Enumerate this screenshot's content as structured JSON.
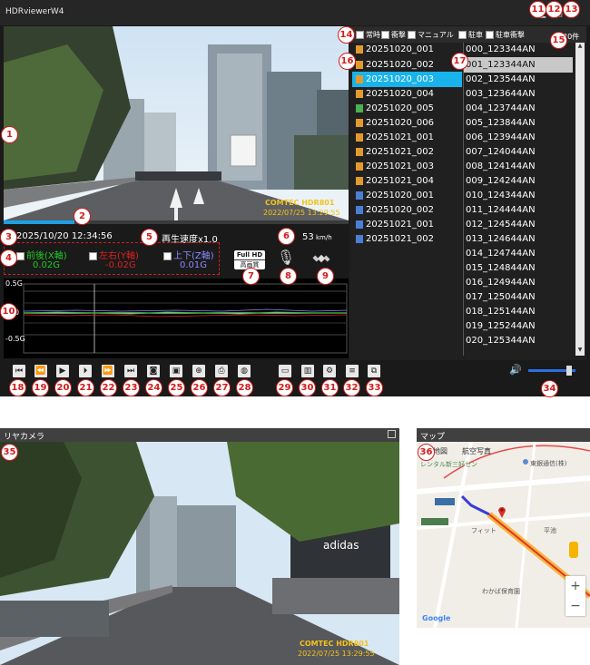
{
  "app": {
    "title": "HDRviewerW4"
  },
  "window_controls": {
    "minimize": "▁",
    "restore": "□",
    "close": "✕"
  },
  "front": {
    "overlay_brand": "COMTEC HDR801",
    "overlay_time": "2022/07/25 13:29:55"
  },
  "info": {
    "datetime": "2025/10/20 12:34:56",
    "playback_speed": "再生速度x1.0",
    "speed": "53",
    "speed_unit": "km/h"
  },
  "gsensor": {
    "items": [
      {
        "label": "前後(X軸)",
        "value": "0.02G",
        "color": "#22cc22"
      },
      {
        "label": "左右(Y軸)",
        "value": "-0.02G",
        "color": "#e02020"
      },
      {
        "label": "上下(Z軸)",
        "value": "0.01G",
        "color": "#8a8aff"
      }
    ],
    "axis_top": "0.5G",
    "axis_mid": "0",
    "axis_bottom": "-0.5G"
  },
  "quality_badge": {
    "line1": "Full HD",
    "line2": "高画質"
  },
  "filters": {
    "items": [
      "常時",
      "衝撃",
      "マニュアル",
      "駐車",
      "駐車衝撃"
    ],
    "count": "20件"
  },
  "files_left": [
    "20251020_001",
    "20251020_002",
    "20251020_003",
    "20251020_004",
    "20251020_005",
    "20251020_006",
    "20251021_001",
    "20251021_002",
    "20251021_003",
    "20251021_004",
    "20251020_001",
    "20251020_002",
    "20251021_001",
    "20251021_002"
  ],
  "files_right": [
    "000_123344AN",
    "001_123344AN",
    "002_123544AN",
    "003_123644AN",
    "004_123744AN",
    "005_123844AN",
    "006_123944AN",
    "007_124044AN",
    "008_124144AN",
    "009_124244AN",
    "010_124344AN",
    "011_124444AN",
    "012_124544AN",
    "013_124644AN",
    "014_124744AN",
    "015_124844AN",
    "016_124944AN",
    "017_125044AN",
    "018_125144AN",
    "019_125244AN",
    "020_125344AN"
  ],
  "rear": {
    "title": "リヤカメラ",
    "overlay_brand": "COMTEC HDR801",
    "overlay_time": "2022/07/25 13:29:55"
  },
  "map": {
    "title": "マップ",
    "tab_map": "地図",
    "tab_sat": "航空写真",
    "zoom_in": "+",
    "zoom_out": "−",
    "logo": "Google",
    "labels": [
      "レンタル新三好セン",
      "東銀通信(株)",
      "フィット",
      "平池",
      "わかば保育園"
    ]
  },
  "callouts": [
    "1",
    "2",
    "3",
    "4",
    "5",
    "6",
    "7",
    "8",
    "9",
    "10",
    "11",
    "12",
    "13",
    "14",
    "15",
    "16",
    "17",
    "18",
    "19",
    "20",
    "21",
    "22",
    "23",
    "24",
    "25",
    "26",
    "27",
    "28",
    "29",
    "30",
    "31",
    "32",
    "33",
    "34",
    "35",
    "36"
  ],
  "colors": {
    "accent": "#1ea0e6",
    "callout": "#d21c1c",
    "selected_row": "#19b3ec"
  }
}
